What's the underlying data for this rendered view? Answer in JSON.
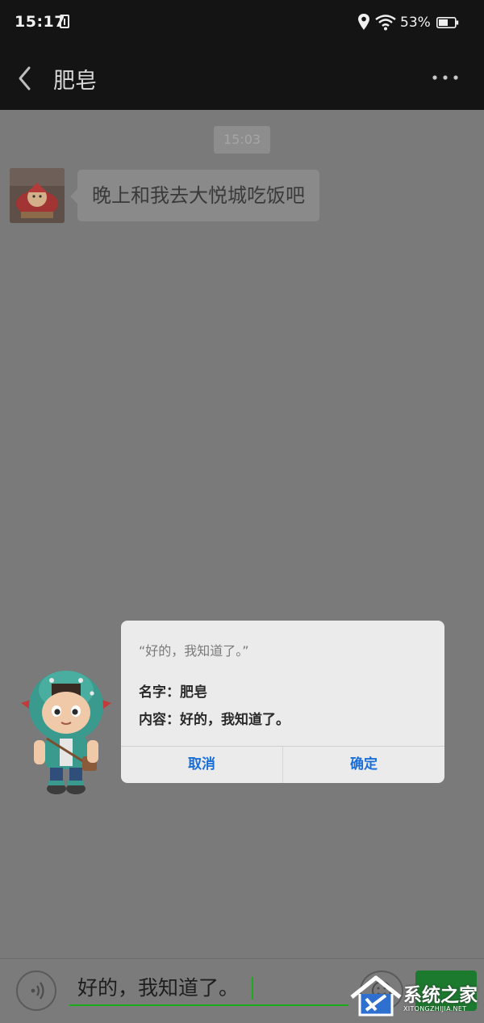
{
  "status_bar": {
    "time": "15:17",
    "battery_percent": "53%",
    "icons": [
      "sim-icon",
      "location-icon",
      "wifi-icon",
      "battery-icon"
    ]
  },
  "header": {
    "title": "肥皂",
    "back_icon": "back-chevron-icon",
    "more_icon": "more-dots-icon"
  },
  "chat": {
    "timestamp": "15:03",
    "messages": [
      {
        "sender": "肥皂",
        "text": "晚上和我去大悦城吃饭吧"
      }
    ]
  },
  "dialog": {
    "title": "“好的，我知道了。”",
    "name_line": "名字：肥皂",
    "content_line": "内容：好的，我知道了。",
    "cancel_label": "取消",
    "ok_label": "确定"
  },
  "input_bar": {
    "value": "好的，我知道了。",
    "voice_icon": "voice-icon",
    "emoji_icon": "emoji-icon"
  },
  "watermark": {
    "title": "系统之家",
    "subtitle": "XITONGZHIJIA.NET"
  },
  "colors": {
    "status_bar_bg": "#141414",
    "chat_bg": "#7a7a7a",
    "dialog_bg": "#ebebeb",
    "dialog_button": "#1a6ed8",
    "input_underline": "#1aad19",
    "send_button": "#1c7a2e"
  }
}
